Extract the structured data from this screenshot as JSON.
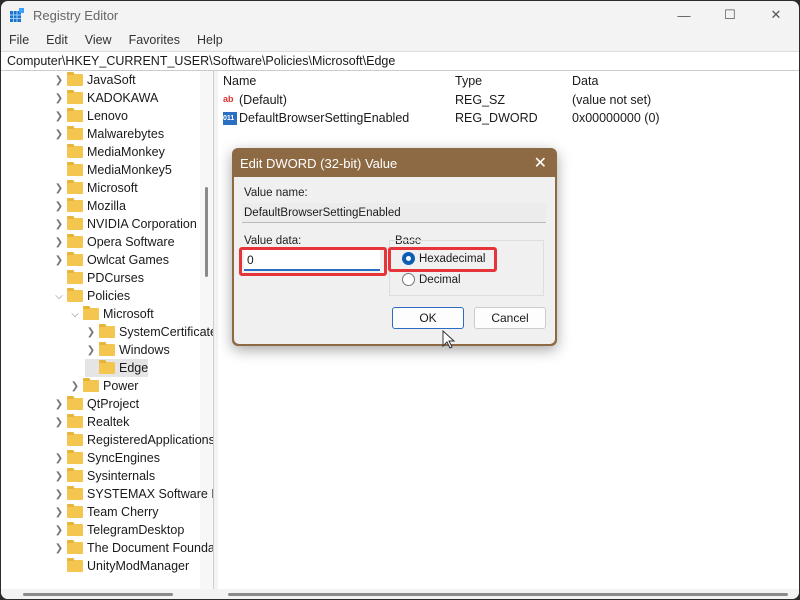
{
  "window": {
    "title": "Registry Editor",
    "controls": [
      "minimize",
      "maximize",
      "close"
    ]
  },
  "menu": [
    "File",
    "Edit",
    "View",
    "Favorites",
    "Help"
  ],
  "address": "Computer\\HKEY_CURRENT_USER\\Software\\Policies\\Microsoft\\Edge",
  "tree": [
    {
      "label": "JavaSoft",
      "level": 1,
      "chevron": "right"
    },
    {
      "label": "KADOKAWA",
      "level": 1,
      "chevron": "right"
    },
    {
      "label": "Lenovo",
      "level": 1,
      "chevron": "right"
    },
    {
      "label": "Malwarebytes",
      "level": 1,
      "chevron": "right"
    },
    {
      "label": "MediaMonkey",
      "level": 1,
      "chevron": ""
    },
    {
      "label": "MediaMonkey5",
      "level": 1,
      "chevron": ""
    },
    {
      "label": "Microsoft",
      "level": 1,
      "chevron": "right"
    },
    {
      "label": "Mozilla",
      "level": 1,
      "chevron": "right"
    },
    {
      "label": "NVIDIA Corporation",
      "level": 1,
      "chevron": "right"
    },
    {
      "label": "Opera Software",
      "level": 1,
      "chevron": "right"
    },
    {
      "label": "Owlcat Games",
      "level": 1,
      "chevron": "right"
    },
    {
      "label": "PDCurses",
      "level": 1,
      "chevron": ""
    },
    {
      "label": "Policies",
      "level": 1,
      "chevron": "down"
    },
    {
      "label": "Microsoft",
      "level": 2,
      "chevron": "down"
    },
    {
      "label": "SystemCertificates",
      "level": 3,
      "chevron": "right"
    },
    {
      "label": "Windows",
      "level": 3,
      "chevron": "right"
    },
    {
      "label": "Edge",
      "level": 3,
      "chevron": "",
      "selected": true
    },
    {
      "label": "Power",
      "level": 2,
      "chevron": "right"
    },
    {
      "label": "QtProject",
      "level": 1,
      "chevron": "right"
    },
    {
      "label": "Realtek",
      "level": 1,
      "chevron": "right"
    },
    {
      "label": "RegisteredApplications",
      "level": 1,
      "chevron": ""
    },
    {
      "label": "SyncEngines",
      "level": 1,
      "chevron": "right"
    },
    {
      "label": "Sysinternals",
      "level": 1,
      "chevron": "right"
    },
    {
      "label": "SYSTEMAX Software Development",
      "level": 1,
      "chevron": "right"
    },
    {
      "label": "Team Cherry",
      "level": 1,
      "chevron": "right"
    },
    {
      "label": "TelegramDesktop",
      "level": 1,
      "chevron": "right"
    },
    {
      "label": "The Document Foundation",
      "level": 1,
      "chevron": "right"
    },
    {
      "label": "UnityModManager",
      "level": 1,
      "chevron": ""
    }
  ],
  "list": {
    "columns": [
      "Name",
      "Type",
      "Data"
    ],
    "rows": [
      {
        "icon": "string-value-icon",
        "name": "(Default)",
        "type": "REG_SZ",
        "data": "(value not set)"
      },
      {
        "icon": "binary-value-icon",
        "name": "DefaultBrowserSettingEnabled",
        "type": "REG_DWORD",
        "data": "0x00000000 (0)"
      }
    ]
  },
  "dialog": {
    "title": "Edit DWORD (32-bit) Value",
    "value_name_label": "Value name:",
    "value_name": "DefaultBrowserSettingEnabled",
    "value_data_label": "Value data:",
    "value_data": "0",
    "base_label": "Base",
    "options": [
      {
        "label": "Hexadecimal",
        "selected": true
      },
      {
        "label": "Decimal",
        "selected": false
      }
    ],
    "ok": "OK",
    "cancel": "Cancel",
    "highlight_color": "#e5343a",
    "frame_color": "#8d6a43"
  }
}
